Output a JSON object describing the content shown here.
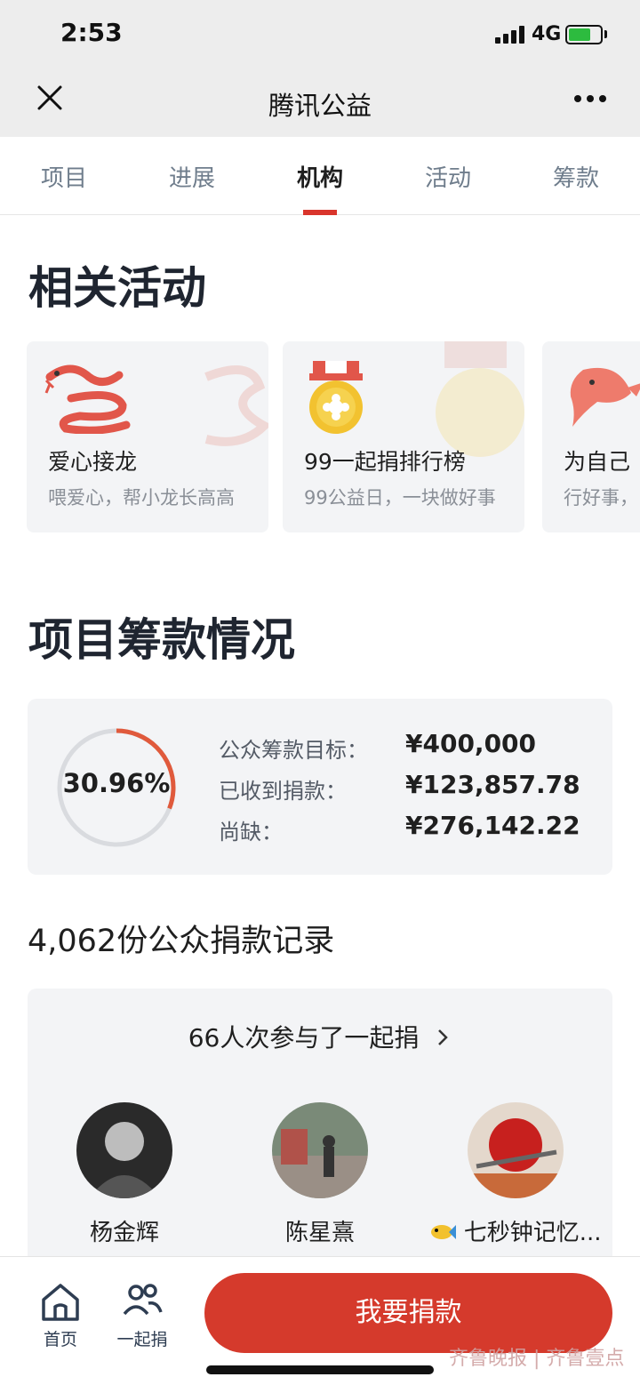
{
  "status_bar": {
    "time": "2:53",
    "network": "4G"
  },
  "nav": {
    "title": "腾讯公益"
  },
  "tabs": [
    {
      "label": "项目"
    },
    {
      "label": "进展"
    },
    {
      "label": "机构"
    },
    {
      "label": "活动"
    },
    {
      "label": "筹款"
    }
  ],
  "active_tab": "机构",
  "activities": {
    "title": "相关活动",
    "cards": [
      {
        "title": "爱心接龙",
        "subtitle": "喂爱心，帮小龙长高高"
      },
      {
        "title": "99一起捐排行榜",
        "subtitle": "99公益日，一块做好事"
      },
      {
        "title": "为自己",
        "subtitle": "行好事，"
      }
    ]
  },
  "funding": {
    "title": "项目筹款情况",
    "percent_label": "30.96%",
    "percent": 30.96,
    "rows": [
      {
        "label": "公众筹款目标：",
        "value": "¥400,000"
      },
      {
        "label": "已收到捐款：",
        "value": "¥123,857.78"
      },
      {
        "label": "尚缺：",
        "value": "¥276,142.22"
      }
    ]
  },
  "records": {
    "title": "4,062份公众捐款记录"
  },
  "donors": {
    "header": "66人次参与了一起捐",
    "list": [
      {
        "name": "杨金辉"
      },
      {
        "name": "陈星熹"
      },
      {
        "name": "七秒钟记忆..."
      }
    ]
  },
  "bottom_bar": {
    "home_label": "首页",
    "together_label": "一起捐",
    "donate_label": "我要捐款",
    "watermark": "齐鲁晚报 | 齐鲁壹点"
  },
  "colors": {
    "accent": "#d53a2c",
    "tab_inactive": "#6f7d8c",
    "card_bg": "#f3f4f6"
  }
}
